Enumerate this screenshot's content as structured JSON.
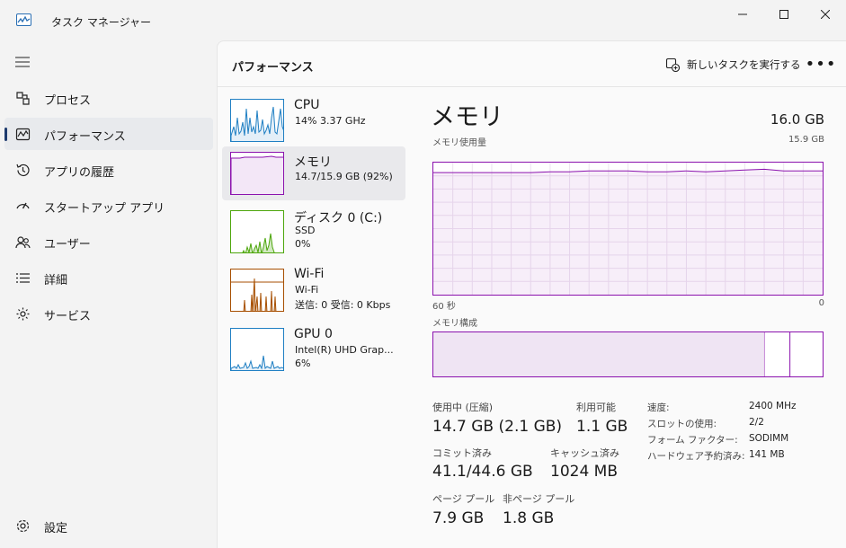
{
  "window": {
    "title": "タスク マネージャー"
  },
  "sidebar": {
    "items": [
      {
        "label": "プロセス",
        "icon": "processes-icon"
      },
      {
        "label": "パフォーマンス",
        "icon": "performance-icon",
        "active": true
      },
      {
        "label": "アプリの履歴",
        "icon": "history-icon"
      },
      {
        "label": "スタートアップ アプリ",
        "icon": "startup-icon"
      },
      {
        "label": "ユーザー",
        "icon": "users-icon"
      },
      {
        "label": "詳細",
        "icon": "details-icon"
      },
      {
        "label": "サービス",
        "icon": "services-icon"
      }
    ],
    "settings_label": "設定"
  },
  "header": {
    "title": "パフォーマンス",
    "new_task_label": "新しいタスクを実行する",
    "more_label": "•••"
  },
  "resources": [
    {
      "name": "CPU",
      "line2": "14%  3.37 GHz",
      "line3": "",
      "color": "#1f7fc3"
    },
    {
      "name": "メモリ",
      "line2": "14.7/15.9 GB (92%)",
      "line3": "",
      "color": "#8b12ae"
    },
    {
      "name": "ディスク 0 (C:)",
      "line2": "SSD",
      "line3": "0%",
      "color": "#4da60c"
    },
    {
      "name": "Wi-Fi",
      "line2": "Wi-Fi",
      "line3": "送信: 0 受信: 0 Kbps",
      "color": "#a74f01"
    },
    {
      "name": "GPU 0",
      "line2": "Intel(R) UHD Grap...",
      "line3": "6%",
      "color": "#1f7fc3"
    }
  ],
  "detail": {
    "title": "メモリ",
    "total": "16.0 GB",
    "usage_label": "メモリ使用量",
    "usage_max": "15.9 GB",
    "time_left": "60 秒",
    "time_right": "0",
    "composition_label": "メモリ構成",
    "composition": {
      "in_use_fraction": 0.93,
      "modified_fraction": 0.005,
      "standby_fraction": 0.05
    }
  },
  "stats": {
    "in_use_label": "使用中 (圧縮)",
    "in_use_value": "14.7 GB (2.1 GB)",
    "available_label": "利用可能",
    "available_value": "1.1 GB",
    "committed_label": "コミット済み",
    "committed_value": "41.1/44.6 GB",
    "cached_label": "キャッシュ済み",
    "cached_value": "1024 MB",
    "paged_label": "ページ プール",
    "paged_value": "7.9 GB",
    "nonpaged_label": "非ページ プール",
    "nonpaged_value": "1.8 GB"
  },
  "specs": [
    {
      "key": "速度:",
      "value": "2400 MHz"
    },
    {
      "key": "スロットの使用:",
      "value": "2/2"
    },
    {
      "key": "フォーム ファクター:",
      "value": "SODIMM"
    },
    {
      "key": "ハードウェア予約済み:",
      "value": "141 MB"
    }
  ],
  "chart_data": {
    "type": "area",
    "title": "メモリ使用量",
    "xlabel": "",
    "ylabel": "",
    "xlim": [
      60,
      0
    ],
    "ylim": [
      0,
      15.9
    ],
    "grid": true,
    "x": [
      60,
      57,
      54,
      51,
      48,
      45,
      42,
      39,
      36,
      33,
      30,
      27,
      24,
      21,
      18,
      15,
      12,
      9,
      6,
      3,
      0
    ],
    "values": [
      14.7,
      14.7,
      14.7,
      14.7,
      14.7,
      14.7,
      14.8,
      14.8,
      14.9,
      14.9,
      14.9,
      14.8,
      14.8,
      14.9,
      14.8,
      14.9,
      15.0,
      15.1,
      14.9,
      14.9,
      14.9
    ],
    "color": "#8b12ae"
  }
}
